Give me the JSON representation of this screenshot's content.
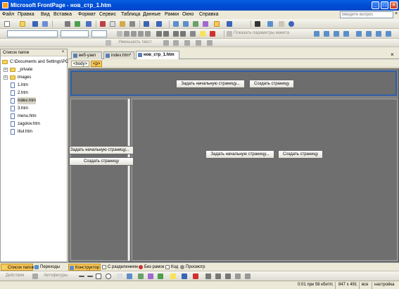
{
  "window": {
    "title": "Microsoft FrontPage - нов_стр_1.htm",
    "min_glyph": "_",
    "max_glyph": "□",
    "close_glyph": "×"
  },
  "menu": {
    "items": [
      "Файл",
      "Правка",
      "Вид",
      "Вставка",
      "Формат",
      "Сервис",
      "Таблица",
      "Данные",
      "Рамки",
      "Окно",
      "Справка"
    ],
    "ask_placeholder": "Введите вопрос",
    "ask_close": "×"
  },
  "toolbars": {
    "code_toolbar_text": "Показать параметры макета",
    "revise_text": "Уменьшить текст"
  },
  "folder_list": {
    "header": "Список папок",
    "close_glyph": "×",
    "root": "C:\\Documents and Settings\\PC",
    "folders": [
      {
        "name": "_private",
        "expander": "+"
      },
      {
        "name": "images",
        "expander": "+"
      }
    ],
    "files": [
      "1.htm",
      "2.htm",
      "index.htm",
      "3.htm",
      "menu.htm",
      "zagolov.htm",
      "titul.htm"
    ],
    "selected_file": "index.htm"
  },
  "doc_tabs": [
    {
      "label": "веб-узел"
    },
    {
      "label": "index.htm*"
    },
    {
      "label": "нов_стр_1.htm"
    }
  ],
  "doc_tabs_close": "×",
  "tag_selector": [
    "<body>",
    "<p>"
  ],
  "frames": {
    "top": {
      "btn_set_start": "Задать начальную страницу...",
      "btn_create": "Создать страницу"
    },
    "left": {
      "btn_set_start": "Задать начальную страницу...",
      "btn_create": "Создать страницу"
    },
    "main": {
      "btn_set_start": "Задать начальную страницу...",
      "btn_create": "Создать страницу"
    }
  },
  "bottom_tabs": {
    "panel_tabs": [
      "Список папок",
      "Переходы"
    ],
    "view_tabs": [
      "Конструктор",
      "С разделением",
      "Без рамок",
      "Код",
      "Просмотр"
    ]
  },
  "drawing": {
    "actions": "Действия",
    "autoshapes": "Автофигуры"
  },
  "status": {
    "speed": "0:01 при 56 кбит/с",
    "size": "847 x 491",
    "mode": "все",
    "custom": "настройка"
  },
  "colors": {
    "titlebar": "#0050d8",
    "frame_border": "#2d5ea9",
    "active_tab": "#f9c85a",
    "design_bg": "#808080"
  }
}
